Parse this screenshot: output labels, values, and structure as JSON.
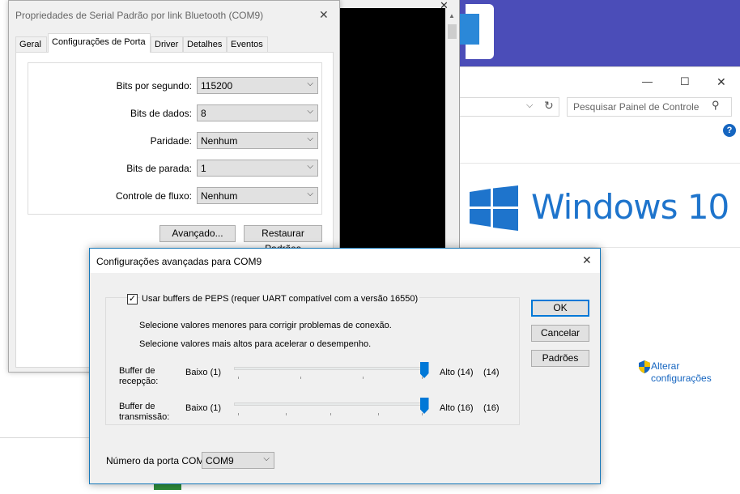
{
  "control_panel": {
    "minimize_glyph": "—",
    "maximize_glyph": "☐",
    "close_glyph": "✕",
    "search_placeholder": "Pesquisar Painel de Controle",
    "help_glyph": "?",
    "windows_brand": "Windows 10",
    "link_line1": "Alterar",
    "link_line2": "configurações",
    "colors": {
      "banner": "#4b4db8",
      "brand_blue": "#1e74cc",
      "link": "#1565c0"
    }
  },
  "properties_dialog": {
    "title": "Propriedades de Serial Padrão por link Bluetooth (COM9)",
    "close_glyph": "✕",
    "tabs": [
      {
        "label": "Geral"
      },
      {
        "label": "Configurações de Porta",
        "active": true
      },
      {
        "label": "Driver"
      },
      {
        "label": "Detalhes"
      },
      {
        "label": "Eventos"
      }
    ],
    "fields": [
      {
        "label": "Bits por segundo:",
        "value": "115200"
      },
      {
        "label": "Bits de dados:",
        "value": "8"
      },
      {
        "label": "Paridade:",
        "value": "Nenhum"
      },
      {
        "label": "Bits de parada:",
        "value": "1"
      },
      {
        "label": "Controle de fluxo:",
        "value": "Nenhum"
      }
    ],
    "advanced_button": "Avançado...",
    "restore_button": "Restaurar Padrões"
  },
  "advanced_dialog": {
    "title": "Configurações avançadas para COM9",
    "close_glyph": "✕",
    "checkbox_label": "Usar buffers de PEPS (requer UART compatível com a versão 16550)",
    "checkbox_checked": true,
    "hint_low": "Selecione valores menores para corrigir problemas de conexão.",
    "hint_high": "Selecione valores mais altos para acelerar o desempenho.",
    "receive": {
      "label_line1": "Buffer de",
      "label_line2": "recepção:",
      "min_label": "Baixo (1)",
      "max_label": "Alto (14)",
      "value": "(14)",
      "level_fraction": 1.0
    },
    "transmit": {
      "label_line1": "Buffer de",
      "label_line2": "transmissão:",
      "min_label": "Baixo (1)",
      "max_label": "Alto (16)",
      "value": "(16)",
      "level_fraction": 1.0
    },
    "ok_button": "OK",
    "cancel_button": "Cancelar",
    "defaults_button": "Padrões",
    "com_port_label": "Número da porta COM:",
    "com_port_value": "COM9"
  }
}
